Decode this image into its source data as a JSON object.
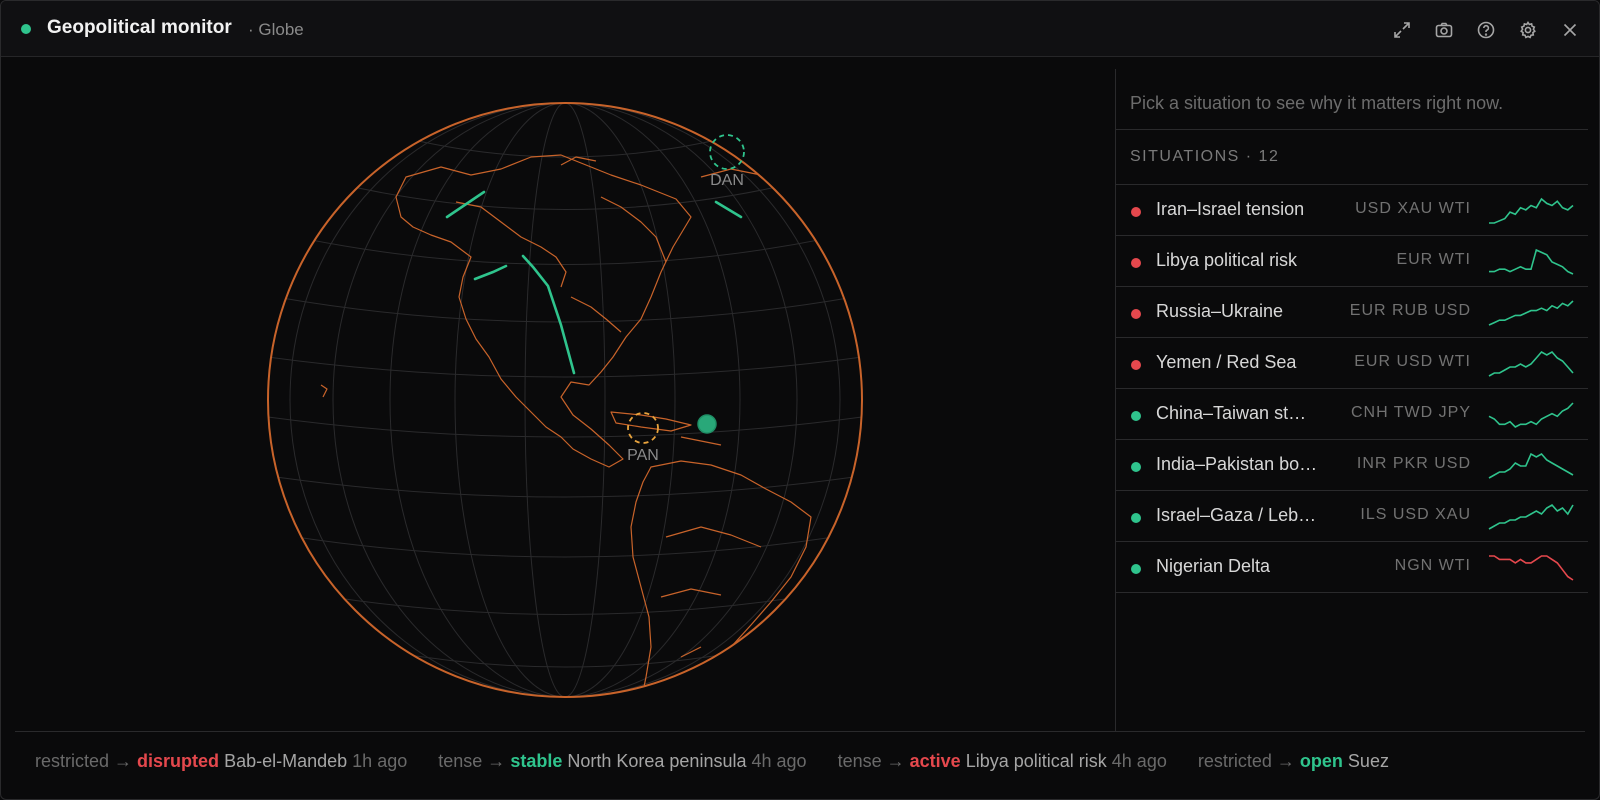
{
  "app": {
    "title": "Geopolitical monitor",
    "subtitle": "· Globe",
    "status_color": "#2fc48d"
  },
  "toolbar": {
    "icons": [
      "expand-icon",
      "camera-icon",
      "help-icon",
      "gear-icon",
      "close-icon"
    ]
  },
  "globe": {
    "markers": [
      {
        "label": "DAN",
        "style": "dashed-ring",
        "color": "#2fc48d"
      },
      {
        "label": "PAN",
        "style": "dashed-ring",
        "color": "#e8a33d"
      },
      {
        "label": "",
        "style": "filled",
        "color": "#2fc48d"
      }
    ]
  },
  "panel": {
    "hint": "Pick a situation to see why it matters right now.",
    "situations_label": "SITUATIONS · 12",
    "items": [
      {
        "name": "Iran–Israel tension",
        "ccy": "USD XAU WTI",
        "status": "#e5484d",
        "spark_color": "#2fc48d",
        "spark": [
          5,
          5,
          6,
          7,
          10,
          9,
          12,
          11,
          13,
          12,
          16,
          14,
          13,
          15,
          12,
          11,
          13
        ]
      },
      {
        "name": "Libya political risk",
        "ccy": "EUR WTI",
        "status": "#e5484d",
        "spark_color": "#2fc48d",
        "spark": [
          6,
          6,
          7,
          7,
          6,
          7,
          8,
          7,
          7,
          15,
          14,
          13,
          10,
          9,
          8,
          6,
          5
        ]
      },
      {
        "name": "Russia–Ukraine",
        "ccy": "EUR RUB USD",
        "status": "#e5484d",
        "spark_color": "#2fc48d",
        "spark": [
          3,
          4,
          5,
          5,
          6,
          7,
          7,
          8,
          9,
          9,
          10,
          9,
          11,
          10,
          12,
          11,
          13
        ]
      },
      {
        "name": "Yemen / Red Sea",
        "ccy": "EUR USD WTI",
        "status": "#e5484d",
        "spark_color": "#2fc48d",
        "spark": [
          4,
          5,
          5,
          6,
          7,
          7,
          8,
          7,
          8,
          10,
          12,
          11,
          12,
          10,
          9,
          7,
          5
        ]
      },
      {
        "name": "China–Taiwan st…",
        "ccy": "CNH TWD JPY",
        "status": "#2fc48d",
        "spark_color": "#2fc48d",
        "spark": [
          9,
          8,
          6,
          6,
          7,
          5,
          6,
          6,
          7,
          6,
          8,
          9,
          10,
          9,
          11,
          12,
          14
        ]
      },
      {
        "name": "India–Pakistan bo…",
        "ccy": "INR PKR USD",
        "status": "#2fc48d",
        "spark_color": "#2fc48d",
        "spark": [
          4,
          5,
          6,
          6,
          7,
          9,
          8,
          8,
          12,
          11,
          12,
          10,
          9,
          8,
          7,
          6,
          5
        ]
      },
      {
        "name": "Israel–Gaza / Leb…",
        "ccy": "ILS USD XAU",
        "status": "#2fc48d",
        "spark_color": "#2fc48d",
        "spark": [
          4,
          5,
          6,
          6,
          7,
          7,
          8,
          8,
          9,
          10,
          9,
          11,
          12,
          10,
          11,
          9,
          12
        ]
      },
      {
        "name": "Nigerian Delta",
        "ccy": "NGN WTI",
        "status": "#2fc48d",
        "spark_color": "#e5484d",
        "spark": [
          14,
          14,
          13,
          13,
          13,
          12,
          13,
          12,
          12,
          13,
          14,
          14,
          13,
          12,
          10,
          8,
          7
        ]
      }
    ]
  },
  "ticker": [
    {
      "from": "restricted",
      "to": "disrupted",
      "to_color": "red",
      "place": "Bab-el-Mandeb",
      "ago": "1h ago"
    },
    {
      "from": "tense",
      "to": "stable",
      "to_color": "green",
      "place": "North Korea peninsula",
      "ago": "4h ago"
    },
    {
      "from": "tense",
      "to": "active",
      "to_color": "red",
      "place": "Libya political risk",
      "ago": "4h ago"
    },
    {
      "from": "restricted",
      "to": "open",
      "to_color": "green",
      "place": "Suez",
      "ago": ""
    }
  ],
  "colors": {
    "accent": "#2fc48d",
    "danger": "#e5484d",
    "globe_outline": "#c8632a",
    "warning": "#e8a33d"
  }
}
